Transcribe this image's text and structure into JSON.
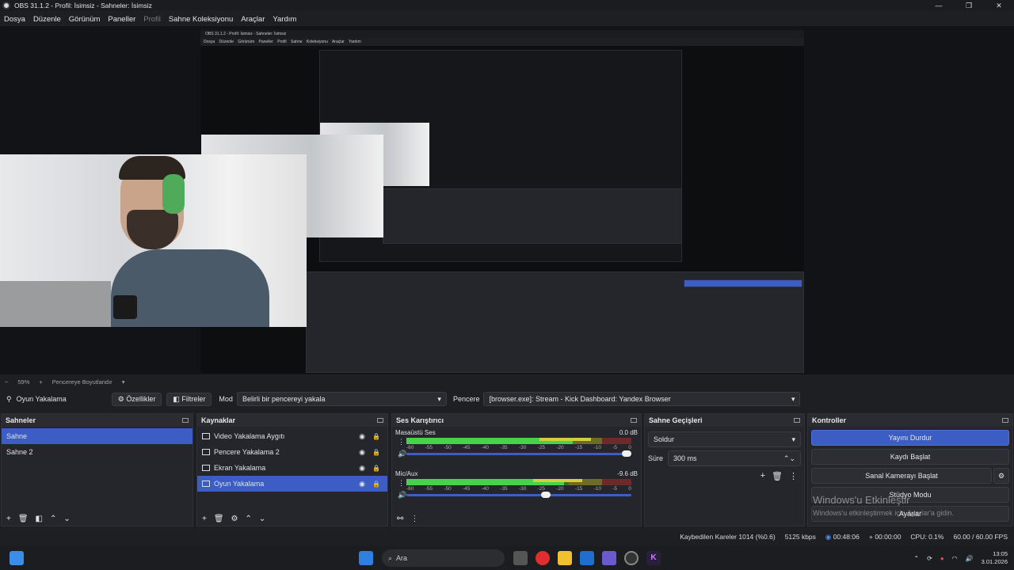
{
  "window": {
    "title": "OBS 31.1.2 - Profil: İsimsiz - Sahneler: İsimsiz",
    "minimize": "—",
    "maximize": "❐",
    "close": "✕"
  },
  "menu": [
    "Dosya",
    "Düzenle",
    "Görünüm",
    "Paneller",
    "Profil",
    "Sahne Koleksiyonu",
    "Araçlar",
    "Yardım"
  ],
  "preview": {
    "nested_title": "OBS 31.1.2 - Profil: İsimsiz - Sahneler: İsimsiz",
    "nested_menu": "Dosya Düzenle Görünüm Paneller Profil Sahne Koleksiyonu Araçlar Yardım"
  },
  "preview_status": {
    "minus": "−",
    "zoom": "59%",
    "plus": "+",
    "fit": "Pencereye Boyutlandır",
    "caret": "▾"
  },
  "source_bar": {
    "current_source": "Oyun Yakalama",
    "properties": "Özellikler",
    "filters": "Filtreler",
    "mode_label": "Mod",
    "mode_value": "Belirli bir pencereyi yakala",
    "window_label": "Pencere",
    "window_value": "[browser.exe]: Stream - Kick Dashboard: Yandex Browser"
  },
  "scenes": {
    "title": "Sahneler",
    "items": [
      "Sahne",
      "Sahne 2"
    ],
    "selected": 0
  },
  "sources": {
    "title": "Kaynaklar",
    "items": [
      {
        "label": "Video Yakalama Aygıtı",
        "icon": "camera-icon"
      },
      {
        "label": "Pencere Yakalama 2",
        "icon": "window-icon"
      },
      {
        "label": "Ekran Yakalama",
        "icon": "monitor-icon"
      },
      {
        "label": "Oyun Yakalama",
        "icon": "gamepad-icon"
      }
    ],
    "selected": 3
  },
  "mixer": {
    "title": "Ses Karıştırıcı",
    "scale": [
      "-60",
      "-55",
      "-50",
      "-45",
      "-40",
      "-35",
      "-30",
      "-25",
      "-20",
      "-15",
      "-10",
      "-5",
      "0"
    ],
    "channels": [
      {
        "name": "Masaüstü Ses",
        "db": "0.0 dB",
        "level": 0.82,
        "volume": 1.0
      },
      {
        "name": "Mic/Aux",
        "db": "-9.6 dB",
        "level": 0.78,
        "volume": 0.64
      }
    ]
  },
  "transitions": {
    "title": "Sahne Geçişleri",
    "type": "Soldur",
    "duration_label": "Süre",
    "duration_value": "300 ms"
  },
  "controls": {
    "title": "Kontroller",
    "stop_stream": "Yayını Durdur",
    "start_record": "Kaydı Başlat",
    "virtual_cam": "Sanal Kamerayı Başlat",
    "studio_mode": "Stüdyo Modu",
    "settings": "Ayarlar"
  },
  "watermark": {
    "line1": "Windows'u Etkinleştir",
    "line2": "Windows'u etkinleştirmek için Ayarlar'a gidin."
  },
  "status": {
    "dropped_frames": "Kaybedilen Kareler 1014 (%0.6)",
    "bitrate": "5125 kbps",
    "stream_time": "00:48:06",
    "record_time": "00:00:00",
    "cpu": "CPU: 0.1%",
    "fps": "60.00 / 60.00 FPS"
  },
  "taskbar": {
    "search": "Ara",
    "time": "13:05",
    "date": "3.01.2026"
  },
  "colors": {
    "accent": "#3c5ec4",
    "meter_green": "#48d14a",
    "meter_yellow": "#d3cf3a"
  }
}
